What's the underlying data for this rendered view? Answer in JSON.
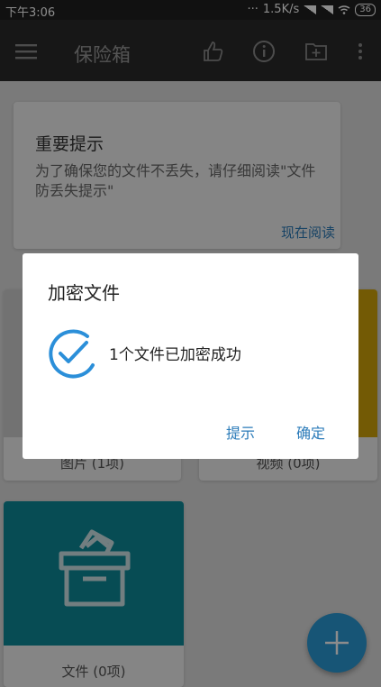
{
  "status_bar": {
    "time": "下午3:06",
    "speed": "1.5K/s",
    "battery": "36"
  },
  "toolbar": {
    "title": "保险箱"
  },
  "notice": {
    "title": "重要提示",
    "body": "为了确保您的文件不丢失，请仔细阅读\"文件防丢失提示\"",
    "action": "现在阅读"
  },
  "tiles": [
    {
      "label": "图片 (1项)"
    },
    {
      "label": "视频 (0项)"
    },
    {
      "label": "文件 (0项)"
    }
  ],
  "dialog": {
    "title": "加密文件",
    "message": "1个文件已加密成功",
    "btn_hint": "提示",
    "btn_ok": "确定"
  },
  "colors": {
    "accent": "#2b7bb9",
    "video_tile": "#d2a40a",
    "files_tile": "#0e8a99",
    "fab": "#2a9bd7"
  }
}
